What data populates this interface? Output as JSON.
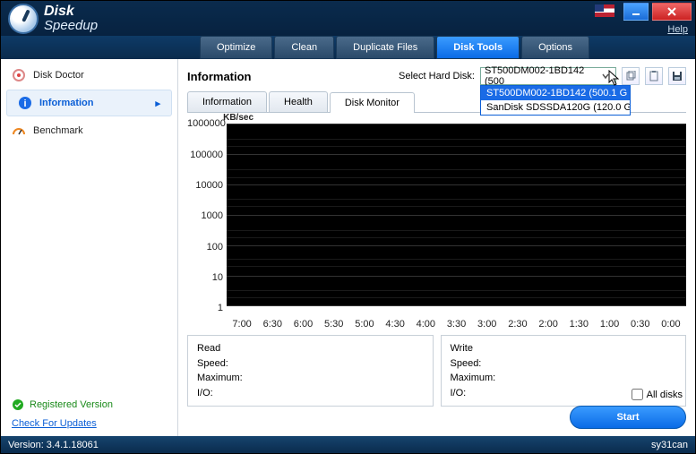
{
  "app": {
    "name1": "Disk",
    "name2": "Speedup"
  },
  "titlebar": {
    "help": "Help"
  },
  "tabs": {
    "optimize": "Optimize",
    "clean": "Clean",
    "duplicate": "Duplicate Files",
    "disktools": "Disk Tools",
    "options": "Options"
  },
  "sidebar": {
    "diskdoctor": "Disk Doctor",
    "information": "Information",
    "benchmark": "Benchmark",
    "registered": "Registered Version",
    "checkupdates": "Check For Updates"
  },
  "main": {
    "title": "Information",
    "selectlabel": "Select Hard Disk:",
    "combo_value": "ST500DM002-1BD142 (500",
    "dd1": "ST500DM002-1BD142 (500.1 G",
    "dd2": "SanDisk SDSSDA120G (120.0 G",
    "subtabs": {
      "info": "Information",
      "health": "Health",
      "diskmon": "Disk Monitor"
    },
    "yunit": "KB/sec",
    "yticks": [
      "1000000",
      "100000",
      "10000",
      "1000",
      "100",
      "10",
      "1"
    ],
    "xticks": [
      "7:00",
      "6:30",
      "6:00",
      "5:30",
      "5:00",
      "4:30",
      "4:00",
      "3:30",
      "3:00",
      "2:30",
      "2:00",
      "1:30",
      "1:00",
      "0:30",
      "0:00"
    ],
    "read": {
      "hd": "Read",
      "speed": "Speed:",
      "max": "Maximum:",
      "io": "I/O:"
    },
    "write": {
      "hd": "Write",
      "speed": "Speed:",
      "max": "Maximum:",
      "io": "I/O:"
    },
    "alldisks": "All disks",
    "start": "Start"
  },
  "status": {
    "version": "Version: 3.4.1.18061",
    "brand": "sy31can"
  },
  "chart_data": {
    "type": "line",
    "title": "",
    "xlabel": "",
    "ylabel": "KB/sec",
    "yscale": "log",
    "ylim": [
      1,
      1000000
    ],
    "x": [
      "7:00",
      "6:30",
      "6:00",
      "5:30",
      "5:00",
      "4:30",
      "4:00",
      "3:30",
      "3:00",
      "2:30",
      "2:00",
      "1:30",
      "1:00",
      "0:30",
      "0:00"
    ],
    "series": [
      {
        "name": "Read",
        "values": []
      },
      {
        "name": "Write",
        "values": []
      }
    ]
  }
}
